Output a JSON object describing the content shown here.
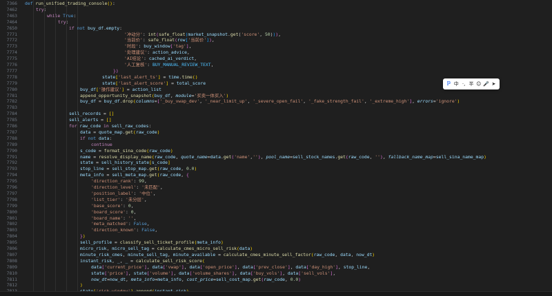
{
  "editor": {
    "lines": [
      {
        "n": "7366",
        "i": 0,
        "html": "<span class=\"def\">def</span> <span class=\"fn\">run_unified_trading_console</span><span class=\"brace\">()</span>:"
      },
      {
        "n": "7462",
        "i": 1,
        "html": "<span class=\"kw\">try</span>:"
      },
      {
        "n": "7463",
        "i": 2,
        "html": "<span class=\"kw\">while</span> <span class=\"def\">True</span>:"
      },
      {
        "n": "7464",
        "i": 3,
        "html": "<span class=\"kw\">try</span>:"
      },
      {
        "n": "7650",
        "i": 4,
        "html": "<span class=\"kw\">if</span> <span class=\"def\">not</span> <span class=\"var\">buy_df</span>.<span class=\"var\">empty</span>:"
      },
      {
        "n": "7771",
        "i": 9,
        "html": "<span class=\"str\">'冲动分'</span>: <span class=\"fn\">int</span><span class=\"brace2\">(</span><span class=\"fn\">safe_float</span><span class=\"brace3\">(</span><span class=\"var\">market_snapshot</span>.<span class=\"fn\">get</span>(<span class=\"str\">'score'</span>, <span class=\"num\">50</span>)<span class=\"brace3\">)</span><span class=\"brace2\">)</span>,"
      },
      {
        "n": "7772",
        "i": 9,
        "html": "<span class=\"str\">'当前价'</span>: <span class=\"fn\">safe_float</span><span class=\"brace2\">(</span><span class=\"var\">row</span><span class=\"brace3\">[</span><span class=\"str\">'当前价'</span><span class=\"brace3\">]</span><span class=\"brace2\">)</span>,"
      },
      {
        "n": "7773",
        "i": 9,
        "html": "<span class=\"str\">'时段'</span>: <span class=\"var\">buy_window</span><span class=\"brace2\">[</span><span class=\"str\">'tag'</span><span class=\"brace2\">]</span>,"
      },
      {
        "n": "7774",
        "i": 9,
        "html": "<span class=\"str\">'处理建议'</span>: <span class=\"var\">action_advice</span>,"
      },
      {
        "n": "7775",
        "i": 9,
        "html": "<span class=\"str\">'AI结论'</span>: <span class=\"var\">cached_ai_verdict</span>,"
      },
      {
        "n": "7776",
        "i": 9,
        "html": "<span class=\"str\">'人工复核'</span>: <span class=\"cst\">BUY_MANUAL_REVIEW_TEXT</span>,"
      },
      {
        "n": "7777",
        "i": 8,
        "html": "<span class=\"brace2\">})</span>"
      },
      {
        "n": "7778",
        "i": 7,
        "html": "<span class=\"var\">state</span><span class=\"brace\">[</span><span class=\"str\">'last_alert_ts'</span><span class=\"brace\">]</span> = <span class=\"var\">time</span>.<span class=\"fn\">time</span><span class=\"brace\">()</span>"
      },
      {
        "n": "7779",
        "i": 7,
        "html": "<span class=\"var\">state</span><span class=\"brace\">[</span><span class=\"str\">'last_alert_score'</span><span class=\"brace\">]</span> = <span class=\"var\">total_score</span>"
      },
      {
        "n": "7780",
        "i": 5,
        "html": "<span class=\"var\">buy_df</span><span class=\"brace\">[</span><span class=\"str\">'操作建议'</span><span class=\"brace\">]</span> = <span class=\"var\">action_list</span>"
      },
      {
        "n": "7781",
        "i": 5,
        "html": "<span class=\"fn\">append_opportunity_snapshot</span><span class=\"brace\">(</span><span class=\"var\">buy_df</span>, <span class=\"ital\">module</span>=<span class=\"str\">'买卖一体买入'</span><span class=\"brace\">)</span>"
      },
      {
        "n": "7782",
        "i": 5,
        "html": "<span class=\"var\">buy_df</span> = <span class=\"var\">buy_df</span>.<span class=\"fn\">drop</span><span class=\"brace\">(</span><span class=\"ital\">columns</span>=<span class=\"brace2\">[</span><span class=\"str\">'_buy_vwap_dev'</span>, <span class=\"str\">'_near_limit_up'</span>, <span class=\"str\">'_severe_open_fail'</span>, <span class=\"str\">'_fake_strength_fail'</span>, <span class=\"str\">'_extreme_high'</span><span class=\"brace2\">]</span>, <span class=\"ital\">errors</span>=<span class=\"str\">'ignore'</span><span class=\"brace\">)</span>"
      },
      {
        "n": "7783",
        "i": 4,
        "html": ""
      },
      {
        "n": "7784",
        "i": 4,
        "html": "<span class=\"var\">sell_records</span> = <span class=\"brace\">[]</span>"
      },
      {
        "n": "7785",
        "i": 4,
        "html": "<span class=\"var\">sell_alerts</span> = <span class=\"brace\">[]</span>"
      },
      {
        "n": "7786",
        "i": 4,
        "html": "<span class=\"kw\">for</span> <span class=\"var\">raw_code</span> <span class=\"kw\">in</span> <span class=\"var\">sell_raw_codes</span>:"
      },
      {
        "n": "7787",
        "i": 5,
        "html": "<span class=\"var\">data</span> = <span class=\"var\">quote_map</span>.<span class=\"fn\">get</span><span class=\"brace\">(</span><span class=\"var\">raw_code</span><span class=\"brace\">)</span>"
      },
      {
        "n": "7788",
        "i": 5,
        "html": "<span class=\"kw\">if</span> <span class=\"def\">not</span> <span class=\"var\">data</span>:"
      },
      {
        "n": "7789",
        "i": 6,
        "html": "<span class=\"kw\">continue</span>"
      },
      {
        "n": "7790",
        "i": 5,
        "html": "<span class=\"var\">s_code</span> = <span class=\"fn\">format_sina_code</span><span class=\"brace\">(</span><span class=\"var\">raw_code</span><span class=\"brace\">)</span>"
      },
      {
        "n": "7791",
        "i": 5,
        "html": "<span class=\"var\">name</span> = <span class=\"fn\">resolve_display_name</span><span class=\"brace\">(</span><span class=\"var\">raw_code</span>, <span class=\"ital\">quote_name</span>=<span class=\"var\">data</span>.<span class=\"fn\">get</span><span class=\"brace2\">(</span><span class=\"str\">'name'</span>,<span class=\"str\">''</span><span class=\"brace2\">)</span>, <span class=\"ital\">pool_name</span>=<span class=\"var\">sell_stock_names</span>.<span class=\"fn\">get</span><span class=\"brace2\">(</span><span class=\"var\">raw_code</span>, <span class=\"str\">''</span><span class=\"brace2\">)</span>, <span class=\"ital\">fallback_name_map</span>=<span class=\"var\">sell_sina_name_map</span><span class=\"brace\">)</span>"
      },
      {
        "n": "7792",
        "i": 5,
        "html": "<span class=\"var\">state</span> = <span class=\"var\">sell_history_state</span><span class=\"brace\">[</span><span class=\"var\">s_code</span><span class=\"brace\">]</span>"
      },
      {
        "n": "7793",
        "i": 5,
        "html": "<span class=\"var\">stop_line</span> = <span class=\"var\">sell_stop_map</span>.<span class=\"fn\">get</span><span class=\"brace\">(</span><span class=\"var\">raw_code</span>, <span class=\"num\">0.0</span><span class=\"brace\">)</span>"
      },
      {
        "n": "7794",
        "i": 5,
        "html": "<span class=\"var\">meta_info</span> = <span class=\"var\">sell_meta_map</span>.<span class=\"fn\">get</span><span class=\"brace\">(</span><span class=\"var\">raw_code</span>, <span class=\"brace2\">{</span>"
      },
      {
        "n": "7795",
        "i": 6,
        "html": "<span class=\"str\">'direction_rank'</span>: <span class=\"num\">99</span>,"
      },
      {
        "n": "7796",
        "i": 6,
        "html": "<span class=\"str\">'direction_level'</span>: <span class=\"str\">'未匹配'</span>,"
      },
      {
        "n": "7797",
        "i": 6,
        "html": "<span class=\"str\">'position_label'</span>: <span class=\"str\">'中位'</span>,"
      },
      {
        "n": "7798",
        "i": 6,
        "html": "<span class=\"str\">'list_tier'</span>: <span class=\"str\">'未分层'</span>,"
      },
      {
        "n": "7799",
        "i": 6,
        "html": "<span class=\"str\">'base_score'</span>: <span class=\"num\">0</span>,"
      },
      {
        "n": "7800",
        "i": 6,
        "html": "<span class=\"str\">'board_score'</span>: <span class=\"num\">0</span>,"
      },
      {
        "n": "7801",
        "i": 6,
        "html": "<span class=\"str\">'board_name'</span>: <span class=\"str\">''</span>,"
      },
      {
        "n": "7802",
        "i": 6,
        "html": "<span class=\"str\">'meta_matched'</span>: <span class=\"def\">False</span>,"
      },
      {
        "n": "7803",
        "i": 6,
        "html": "<span class=\"str\">'direction_known'</span>: <span class=\"def\">False</span>,"
      },
      {
        "n": "7804",
        "i": 5,
        "html": "<span class=\"brace2\">}</span><span class=\"brace\">)</span>"
      },
      {
        "n": "7805",
        "i": 5,
        "html": "<span class=\"var\">sell_profile</span> = <span class=\"fn\">classify_sell_ticket_profile</span><span class=\"brace\">(</span><span class=\"var\">meta_info</span><span class=\"brace\">)</span>"
      },
      {
        "n": "7806",
        "i": 5,
        "html": "<span class=\"var\">micro_risk</span>, <span class=\"var\">micro_sell_tag</span> = <span class=\"fn\">calculate_cmes_micro_sell_risk</span><span class=\"brace\">(</span><span class=\"var\">data</span><span class=\"brace\">)</span>"
      },
      {
        "n": "7807",
        "i": 5,
        "html": "<span class=\"var\">minute_risk_cmes</span>, <span class=\"var\">minute_sell_tag</span>, <span class=\"var\">minute_available</span> = <span class=\"fn\">calculate_cmes_minute_sell_factor</span><span class=\"brace\">(</span><span class=\"var\">raw_code</span>, <span class=\"var\">data</span>, <span class=\"var\">now_dt</span><span class=\"brace\">)</span>"
      },
      {
        "n": "7808",
        "i": 5,
        "html": "<span class=\"var\">instant_risk</span>, <span class=\"var\">_</span>, <span class=\"var\">_</span> = <span class=\"fn\">calculate_sell_risk_score</span><span class=\"brace\">(</span>"
      },
      {
        "n": "7809",
        "i": 6,
        "html": "<span class=\"var\">data</span><span class=\"brace2\">[</span><span class=\"str\">'current_price'</span><span class=\"brace2\">]</span>, <span class=\"var\">data</span><span class=\"brace2\">[</span><span class=\"str\">'vwap'</span><span class=\"brace2\">]</span>, <span class=\"var\">data</span><span class=\"brace2\">[</span><span class=\"str\">'open_price'</span><span class=\"brace2\">]</span>, <span class=\"var\">data</span><span class=\"brace2\">[</span><span class=\"str\">'prev_close'</span><span class=\"brace2\">]</span>, <span class=\"var\">data</span><span class=\"brace2\">[</span><span class=\"str\">'day_high'</span><span class=\"brace2\">]</span>, <span class=\"var\">stop_line</span>,"
      },
      {
        "n": "7810",
        "i": 6,
        "html": "<span class=\"var\">state</span><span class=\"brace2\">[</span><span class=\"str\">'price'</span><span class=\"brace2\">]</span>, <span class=\"var\">state</span><span class=\"brace2\">[</span><span class=\"str\">'volume'</span><span class=\"brace2\">]</span>, <span class=\"var\">data</span><span class=\"brace2\">[</span><span class=\"str\">'volume_shares'</span><span class=\"brace2\">]</span>, <span class=\"var\">data</span><span class=\"brace2\">[</span><span class=\"str\">'buy_vols'</span><span class=\"brace2\">]</span>, <span class=\"var\">data</span><span class=\"brace2\">[</span><span class=\"str\">'sell_vols'</span><span class=\"brace2\">]</span>,"
      },
      {
        "n": "7811",
        "i": 6,
        "html": "<span class=\"ital\">now_dt</span>=<span class=\"var\">now_dt</span>, <span class=\"ital\">meta_info</span>=<span class=\"var\">meta_info</span>, <span class=\"ital\">cost_price</span>=<span class=\"var\">sell_cost_map</span>.<span class=\"fn\">get</span><span class=\"brace2\">(</span><span class=\"var\">raw_code</span>, <span class=\"num\">0.0</span><span class=\"brace2\">)</span>"
      },
      {
        "n": "7812",
        "i": 5,
        "html": "<span class=\"brace\">)</span>"
      },
      {
        "n": "7813",
        "i": 5,
        "html": "<span class=\"var\">state</span><span class=\"brace\">[</span><span class=\"str\">'risk_window'</span><span class=\"brace\">]</span>.<span class=\"fn\">append</span><span class=\"brace\">(</span><span class=\"var\">instant_risk</span><span class=\"brace\">)</span>"
      }
    ]
  },
  "ime_toolbar": {
    "buttons": [
      {
        "name": "ime-logo-icon",
        "label": "ℙ"
      },
      {
        "name": "ime-chinese-mode",
        "label": "中"
      },
      {
        "name": "ime-punctuation-icon",
        "label": "·,"
      },
      {
        "name": "ime-halfwidth-icon",
        "label": "半"
      },
      {
        "name": "ime-emoji-icon",
        "label": "☺"
      },
      {
        "name": "ime-voice-icon",
        "label": "🎤"
      },
      {
        "name": "ime-send-icon",
        "label": "➤"
      }
    ]
  }
}
